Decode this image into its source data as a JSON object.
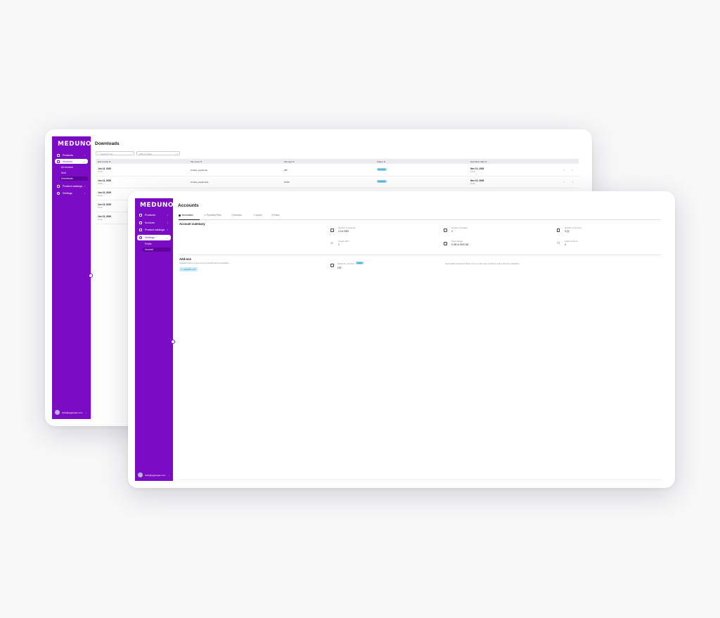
{
  "brand": "MEDUNO",
  "back_window": {
    "title": "Downloads",
    "search_placeholder": "Search for file",
    "filter_placeholder": "Filter by status",
    "nav": [
      {
        "label": "Products"
      },
      {
        "label": "Invoices"
      },
      {
        "label": "Product catalogs"
      },
      {
        "label": "Settings"
      }
    ],
    "subnav": [
      {
        "label": "All invoices"
      },
      {
        "label": "Sent"
      },
      {
        "label": "Downloads"
      }
    ],
    "columns": [
      "Export date ⇅",
      "File name ⇅",
      "File type ⇅",
      "Status ⇅",
      "Expiration date ⇅"
    ],
    "rows": [
      {
        "date": "Jun 13, 2026",
        "time": "13:14",
        "file": "invoice_export.zip",
        "type": "ZIP",
        "status": "Finished",
        "exp": "Nov 13, 2026",
        "exp_time": "13:14"
      },
      {
        "date": "Jun 13, 2026",
        "time": "12:44",
        "file": "invoice_export.xlsx",
        "type": "XLSX",
        "status": "Finished",
        "exp": "Nov 13, 2026",
        "exp_time": "12:44"
      },
      {
        "date": "Jun 13, 2026",
        "time": "12:22",
        "file": "",
        "type": "",
        "status": "",
        "exp": "",
        "exp_time": ""
      },
      {
        "date": "Jun 13, 2026",
        "time": "12:00",
        "file": "",
        "type": "",
        "status": "",
        "exp": "",
        "exp_time": ""
      },
      {
        "date": "Jun 13, 2026",
        "time": "11:40",
        "file": "",
        "type": "",
        "status": "",
        "exp": "",
        "exp_time": ""
      }
    ],
    "user_email": "hello@aggregate.com"
  },
  "front_window": {
    "title": "Accounts",
    "nav": [
      {
        "label": "Products"
      },
      {
        "label": "Invoices"
      },
      {
        "label": "Product catalogs"
      },
      {
        "label": "Settings"
      }
    ],
    "subnav": [
      {
        "label": "Profile"
      },
      {
        "label": "Account"
      }
    ],
    "tabs": [
      {
        "label": "Information"
      },
      {
        "label": "Payment Plan"
      },
      {
        "label": "Invoices"
      },
      {
        "label": "Users"
      },
      {
        "label": "Roles"
      }
    ],
    "summary_title": "Account summary",
    "summary_items": [
      {
        "label": "Number of products",
        "value": "12 of 2000",
        "icon": "box-icon"
      },
      {
        "label": "Number of images",
        "value": "0",
        "icon": "image-icon"
      },
      {
        "label": "Number of invoices",
        "value": "0 (0)",
        "icon": "file-icon"
      },
      {
        "label": "Unique SKU",
        "value": "2",
        "icon": "tag-icon"
      },
      {
        "label": "Data storage",
        "value": "0 GB of 2000 GB",
        "icon": "storage-icon"
      },
      {
        "label": "Total members",
        "value": "3",
        "icon": "users-icon"
      }
    ],
    "addons_title": "Add-ons",
    "addons_desc": "Upgrade features or get more of a specific type of capabilities",
    "upgrade_label": "Upgrade now",
    "addon_item_label": "Maximum members",
    "addon_item_badge": "Active",
    "addon_item_value": "100",
    "addon_note": "Need additional features? Reach out to our sales team to discuss custom plans and capabilities",
    "user_email": "hello@aggregate.com"
  },
  "colors": {
    "sidebar": "#7b0cc4",
    "sidebar_selected": "#5e0399",
    "badge": "#8ad5f0"
  }
}
